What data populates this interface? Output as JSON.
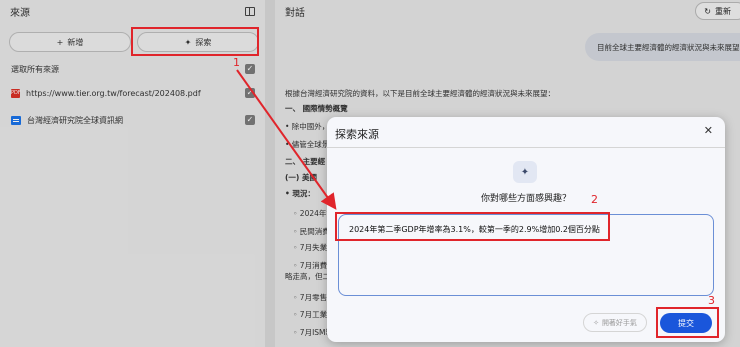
{
  "sources_panel": {
    "title": "來源",
    "add_label": "新增",
    "search_label": "探索",
    "select_all_label": "選取所有來源",
    "sources": [
      {
        "icon": "pdf-icon",
        "label": "https://www.tier.org.tw/forecast/202408.pdf"
      },
      {
        "icon": "web-icon",
        "label": "台灣經濟研究院全球資訊網"
      }
    ]
  },
  "chat_panel": {
    "title": "對話",
    "refresh_label": "重新",
    "user_message": "目前全球主要經濟體的經濟狀況與未來展望為何",
    "response_lines": [
      "根據台灣經濟研究院的資料，以下是目前全球主要經濟體的經濟狀況與未來展望：",
      "一、 國際情勢概覽",
      "• 除中國外，",
      "• 儘管全球景",
      "二、 主要經",
      "(一) 美國",
      "• 現況：",
      "◦ 2024年第",
      "◦ 民間消費",
      "◦ 7月失業率",
      "◦ 7月消費者",
      "略走高，但二",
      "◦ 7月零售銷",
      "◦ 7月工業生",
      "◦ 7月ISM製"
    ]
  },
  "dialog": {
    "title": "探索來源",
    "question": "你對哪些方面感興趣？",
    "input_value": "2024年第二季GDP年增率為3.1%，較第一季的2.9%增加0.2個百分點",
    "feel_lucky_label": "開著好手氣",
    "submit_label": "提交"
  },
  "annotations": [
    "1",
    "2",
    "3"
  ],
  "colors": {
    "annotation": "#e0252b",
    "submit": "#1a56db"
  }
}
